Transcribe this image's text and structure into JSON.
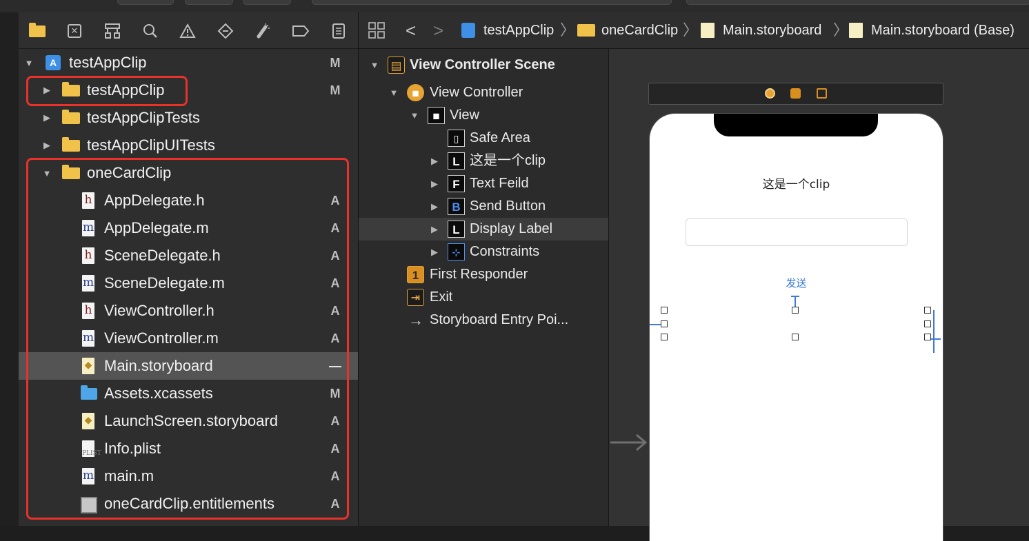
{
  "navigator": {
    "toolbar_icons": [
      "folder-icon",
      "source-control-icon",
      "hierarchy-icon",
      "find-icon",
      "issue-icon",
      "test-icon",
      "debug-icon",
      "breakpoint-icon",
      "report-icon"
    ],
    "rows": [
      {
        "label": "testAppClip",
        "status": "M",
        "icon": "project",
        "disclosure": "▼"
      },
      {
        "label": "testAppClip",
        "status": "M",
        "icon": "folder",
        "disclosure": "▶"
      },
      {
        "label": "testAppClipTests",
        "status": "",
        "icon": "folder",
        "disclosure": "▶"
      },
      {
        "label": "testAppClipUITests",
        "status": "",
        "icon": "folder",
        "disclosure": "▶"
      },
      {
        "label": "oneCardClip",
        "status": "",
        "icon": "folder",
        "disclosure": "▼"
      },
      {
        "label": "AppDelegate.h",
        "status": "A",
        "icon": "h"
      },
      {
        "label": "AppDelegate.m",
        "status": "A",
        "icon": "m"
      },
      {
        "label": "SceneDelegate.h",
        "status": "A",
        "icon": "h"
      },
      {
        "label": "SceneDelegate.m",
        "status": "A",
        "icon": "m"
      },
      {
        "label": "ViewController.h",
        "status": "A",
        "icon": "h"
      },
      {
        "label": "ViewController.m",
        "status": "A",
        "icon": "m"
      },
      {
        "label": "Main.storyboard",
        "status": "—",
        "icon": "storyboard",
        "selected": true
      },
      {
        "label": "Assets.xcassets",
        "status": "M",
        "icon": "assets"
      },
      {
        "label": "LaunchScreen.storyboard",
        "status": "A",
        "icon": "storyboard"
      },
      {
        "label": "Info.plist",
        "status": "A",
        "icon": "plist"
      },
      {
        "label": "main.m",
        "status": "A",
        "icon": "m"
      },
      {
        "label": "oneCardClip.entitlements",
        "status": "A",
        "icon": "entitlements"
      }
    ]
  },
  "jumpbar": {
    "crumbs": [
      "testAppClip",
      "oneCardClip",
      "Main.storyboard",
      "Main.storyboard (Base)"
    ],
    "back_glyph": "<",
    "forward_glyph": ">",
    "separator": "〉"
  },
  "outline": {
    "rows": [
      {
        "label": "View Controller Scene",
        "badge": "",
        "bold": true
      },
      {
        "label": "View Controller",
        "badge": ""
      },
      {
        "label": "View",
        "badge": ""
      },
      {
        "label": "Safe Area",
        "badge": ""
      },
      {
        "label": "这是一个clip",
        "badge": "L"
      },
      {
        "label": "Text Feild",
        "badge": "F"
      },
      {
        "label": "Send Button",
        "badge": "B"
      },
      {
        "label": "Display Label",
        "badge": "L",
        "selected": true
      },
      {
        "label": "Constraints",
        "badge": ""
      },
      {
        "label": "First Responder",
        "badge": ""
      },
      {
        "label": "Exit",
        "badge": ""
      },
      {
        "label": "Storyboard Entry Poi...",
        "badge": ""
      }
    ]
  },
  "canvas": {
    "label_text": "这是一个clip",
    "button_text": "发送"
  },
  "colors": {
    "highlight_box": "#e8322a",
    "folder": "#f0c24a",
    "button_text": "#3476d8"
  }
}
